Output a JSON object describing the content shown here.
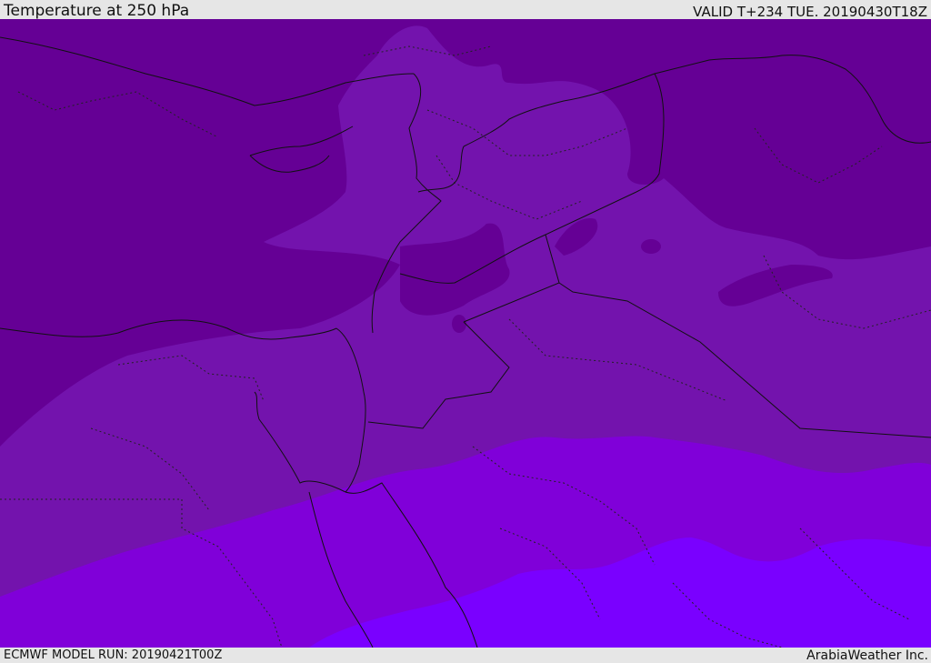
{
  "header": {
    "title": "Temperature at 250 hPa",
    "valid": "VALID T+234 TUE. 20190430T18Z"
  },
  "footer": {
    "model_run": "ECMWF MODEL RUN: 20190421T00Z",
    "credit": "ArabiaWeather Inc."
  },
  "map": {
    "colors": {
      "coldest": "#650095",
      "cold": "#7313ad",
      "mid": "#8000d9",
      "warm": "#8b00f2",
      "warmest": "#7a00ff",
      "border": "#111111"
    }
  }
}
